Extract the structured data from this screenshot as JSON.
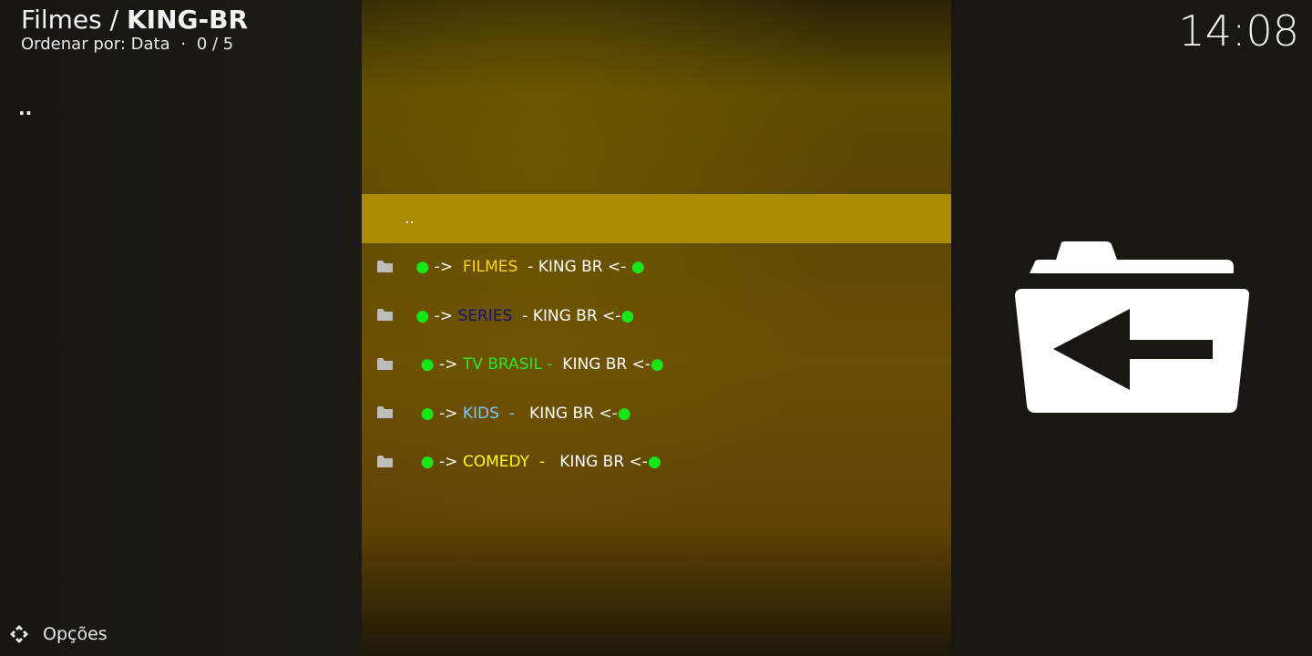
{
  "header": {
    "breadcrumb_parent": "Filmes / ",
    "breadcrumb_current": "KING-BR",
    "sort_label": "Ordenar por: Data",
    "separator": "·",
    "position": "0 / 5",
    "clock": "14:08"
  },
  "sidebar": {
    "parent_item": ".."
  },
  "footer": {
    "options_label": "Opções"
  },
  "list": {
    "parent_row": "..",
    "items": [
      {
        "lead": " ● ",
        "arrow_in": "-> ",
        "name": " FILMES ",
        "name_color": "#ffd21f",
        "dash": " - ",
        "dash_color": "#ffffff",
        "suffix": "KING BR <- ",
        "trail": "●"
      },
      {
        "lead": " ● ",
        "arrow_in": "-> ",
        "name": "SERIES",
        "name_color": "#14136e",
        "dash": "  - ",
        "dash_color": "#ffffff",
        "suffix": "KING BR <-",
        "trail": "●"
      },
      {
        "lead": "  ● ",
        "arrow_in": "-> ",
        "name": "TV BRASIL",
        "name_color": "#28e628",
        "dash": " - ",
        "dash_color": "#28e628",
        "suffix": " KING BR <-",
        "trail": "●"
      },
      {
        "lead": "  ● ",
        "arrow_in": "-> ",
        "name": "KIDS",
        "name_color": "#7ec8f0",
        "dash": "  -  ",
        "dash_color": "#7ec8f0",
        "suffix": " KING BR <-",
        "trail": "●"
      },
      {
        "lead": "  ● ",
        "arrow_in": "-> ",
        "name": "COMEDY",
        "name_color": "#ffff14",
        "dash": "  -  ",
        "dash_color": "#ffff14",
        "suffix": " KING BR <-",
        "trail": "●"
      }
    ]
  },
  "icons": {
    "folder": "folder-icon",
    "back_folder": "folder-back-icon",
    "options": "options-icon"
  }
}
